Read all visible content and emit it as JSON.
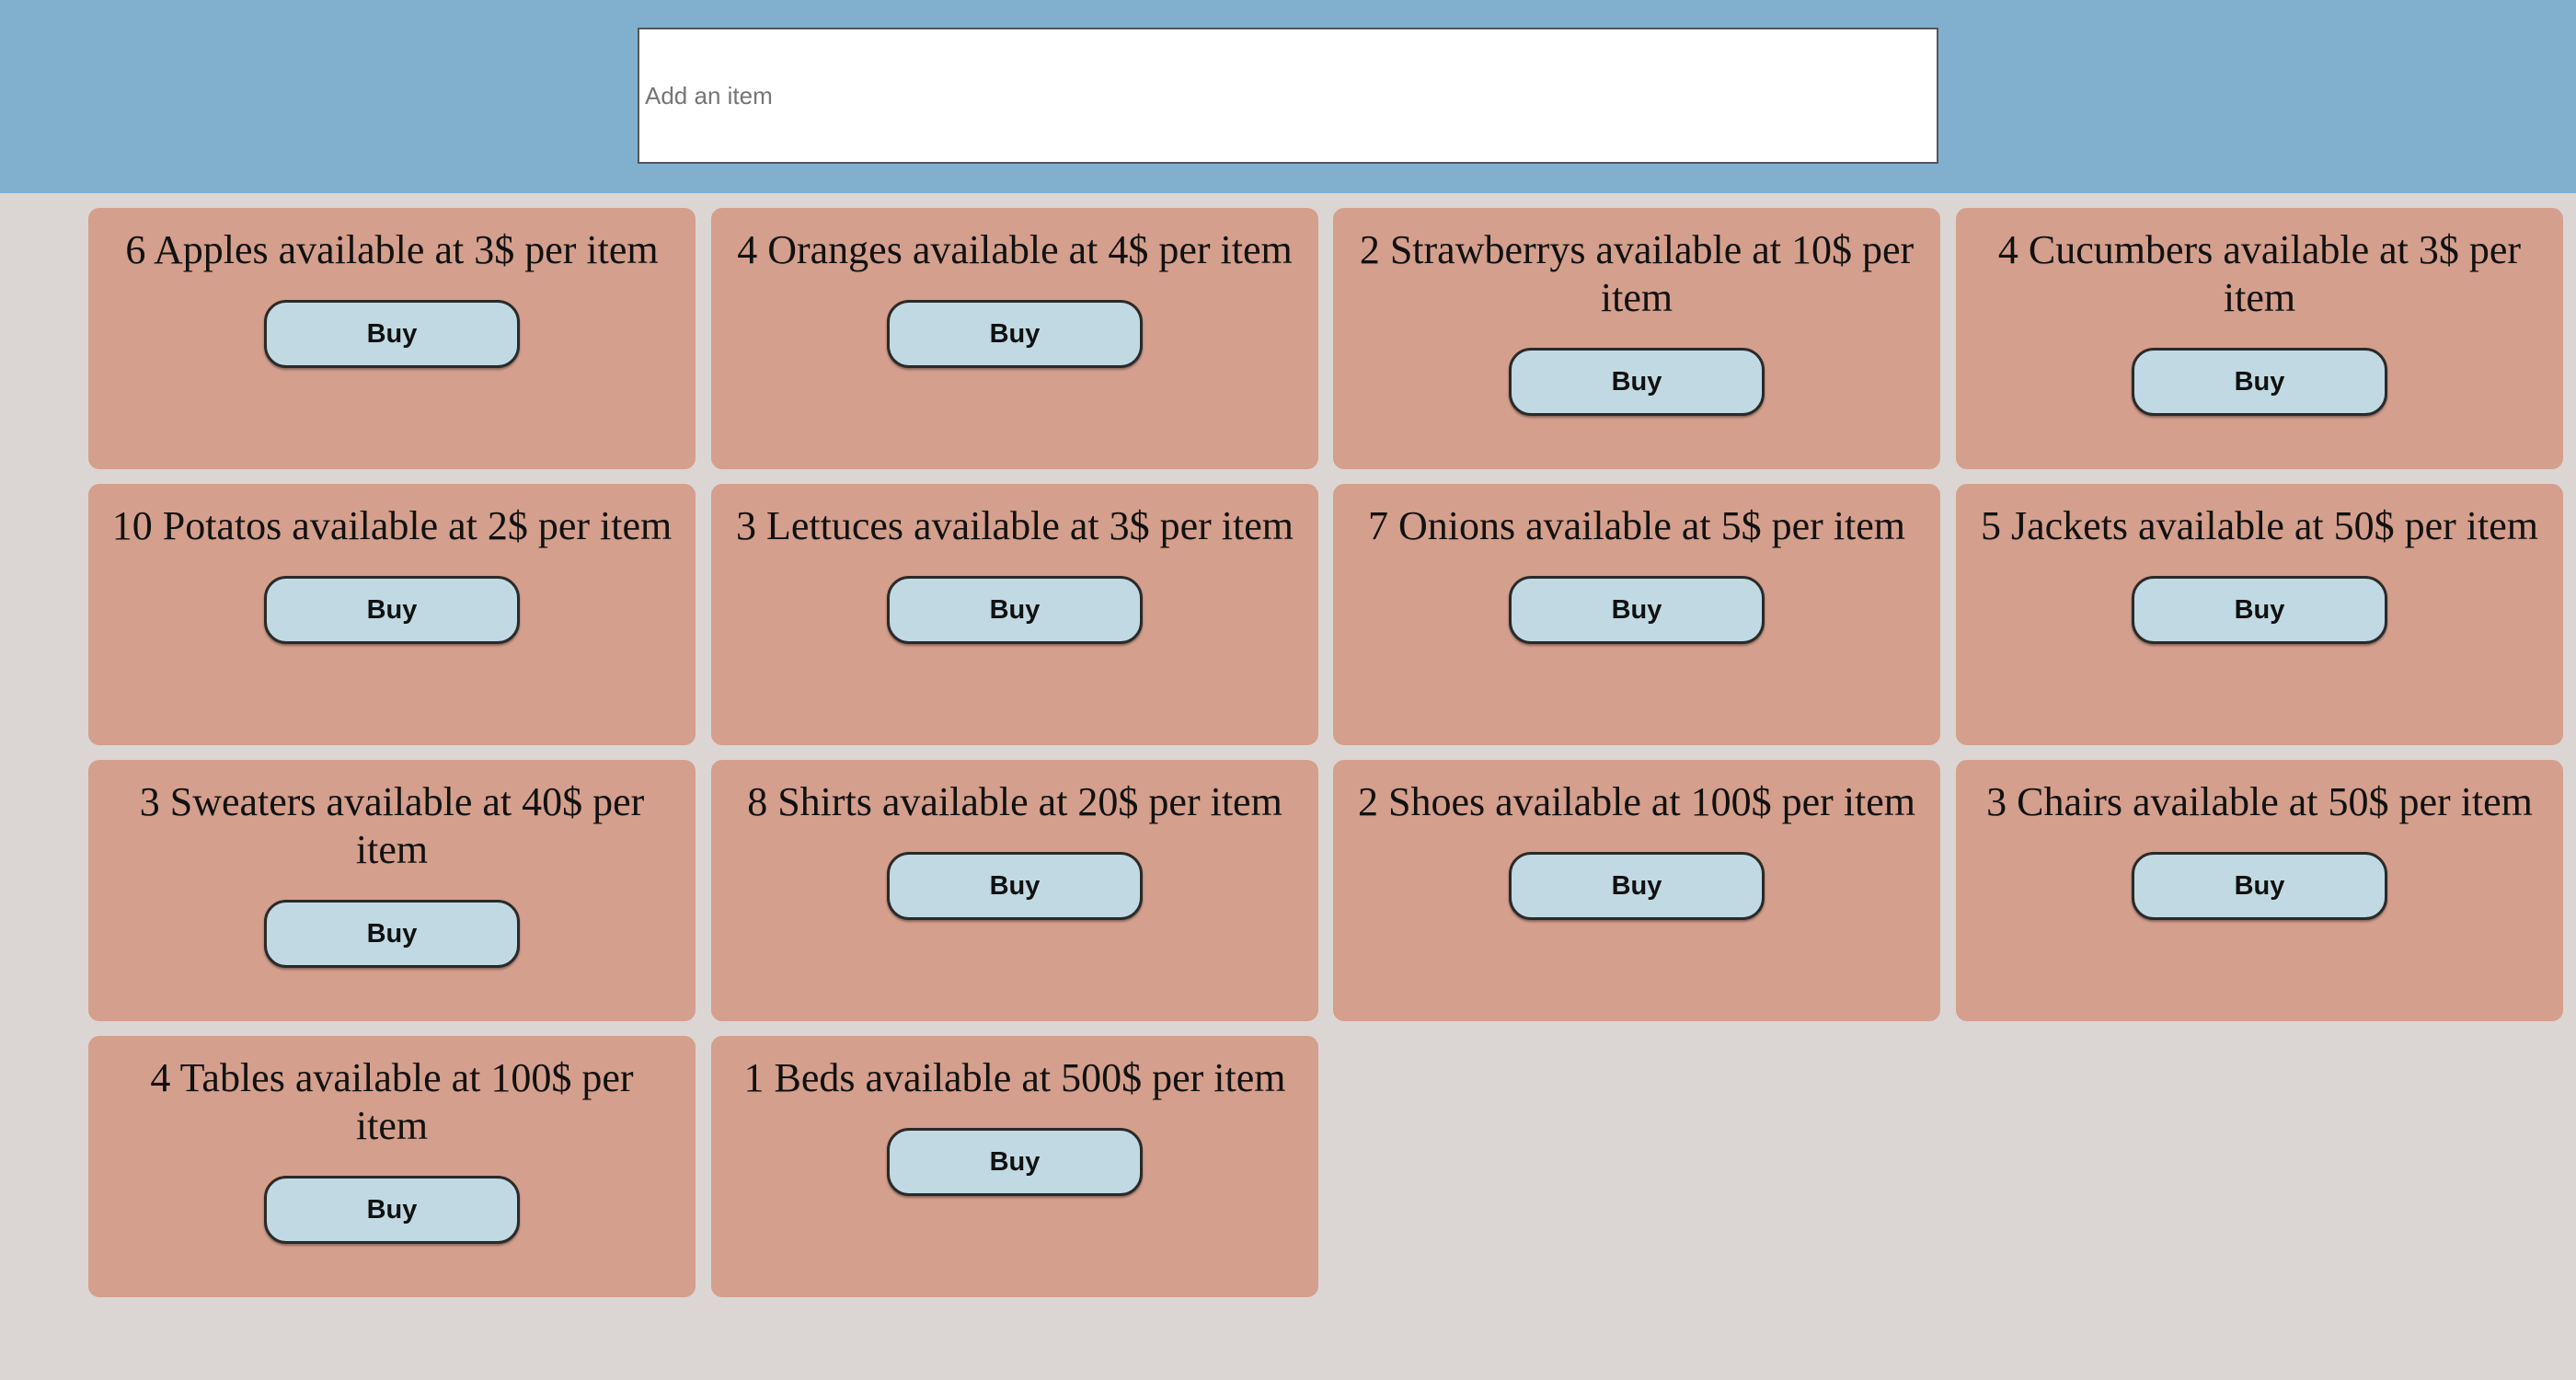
{
  "search": {
    "placeholder": "Add an item",
    "value": ""
  },
  "colors": {
    "header_bg": "#80b0ce",
    "page_bg": "#dbd6d4",
    "card_bg": "#d49f8c",
    "button_bg": "#c1d9e2"
  },
  "items": [
    {
      "text": "6 Apples available at 3$ per item",
      "button": "Buy"
    },
    {
      "text": "4 Oranges available at 4$ per item",
      "button": "Buy"
    },
    {
      "text": "2 Strawberrys available at 10$ per item",
      "button": "Buy"
    },
    {
      "text": "4 Cucumbers available at 3$ per item",
      "button": "Buy"
    },
    {
      "text": "10 Potatos available at 2$ per item",
      "button": "Buy"
    },
    {
      "text": "3 Lettuces available at 3$ per item",
      "button": "Buy"
    },
    {
      "text": "7 Onions available at 5$ per item",
      "button": "Buy"
    },
    {
      "text": "5 Jackets available at 50$ per item",
      "button": "Buy"
    },
    {
      "text": "3 Sweaters available at 40$ per item",
      "button": "Buy"
    },
    {
      "text": "8 Shirts available at 20$ per item",
      "button": "Buy"
    },
    {
      "text": "2 Shoes available at 100$ per item",
      "button": "Buy"
    },
    {
      "text": "3 Chairs available at 50$ per item",
      "button": "Buy"
    },
    {
      "text": "4 Tables available at 100$ per item",
      "button": "Buy"
    },
    {
      "text": "1 Beds available at 500$ per item",
      "button": "Buy"
    }
  ]
}
